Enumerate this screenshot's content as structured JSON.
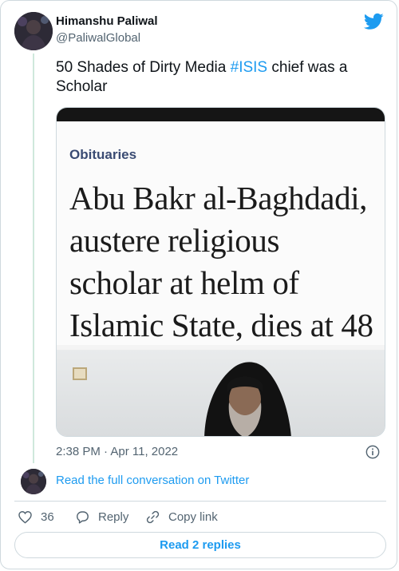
{
  "author": {
    "name": "Himanshu Paliwal",
    "handle": "@PaliwalGlobal"
  },
  "tweet": {
    "text_before": "50 Shades of Dirty Media ",
    "hashtag": "#ISIS",
    "text_after": " chief was a Scholar"
  },
  "media": {
    "section": "Obituaries",
    "headline_lines": [
      "Abu Bakr al-Baghdadi,",
      "austere religious",
      "scholar at helm of",
      "Islamic State, dies at 48"
    ]
  },
  "meta": {
    "timestamp": "2:38 PM · Apr 11, 2022"
  },
  "conversation": {
    "link_text": "Read the full conversation on Twitter"
  },
  "actions": {
    "like_count": "36",
    "reply_label": "Reply",
    "copy_label": "Copy link"
  },
  "replies_button": "Read 2 replies",
  "colors": {
    "accent": "#1d9bf0",
    "text": "#0f1419",
    "muted": "#536471",
    "border": "#cfd9de"
  }
}
